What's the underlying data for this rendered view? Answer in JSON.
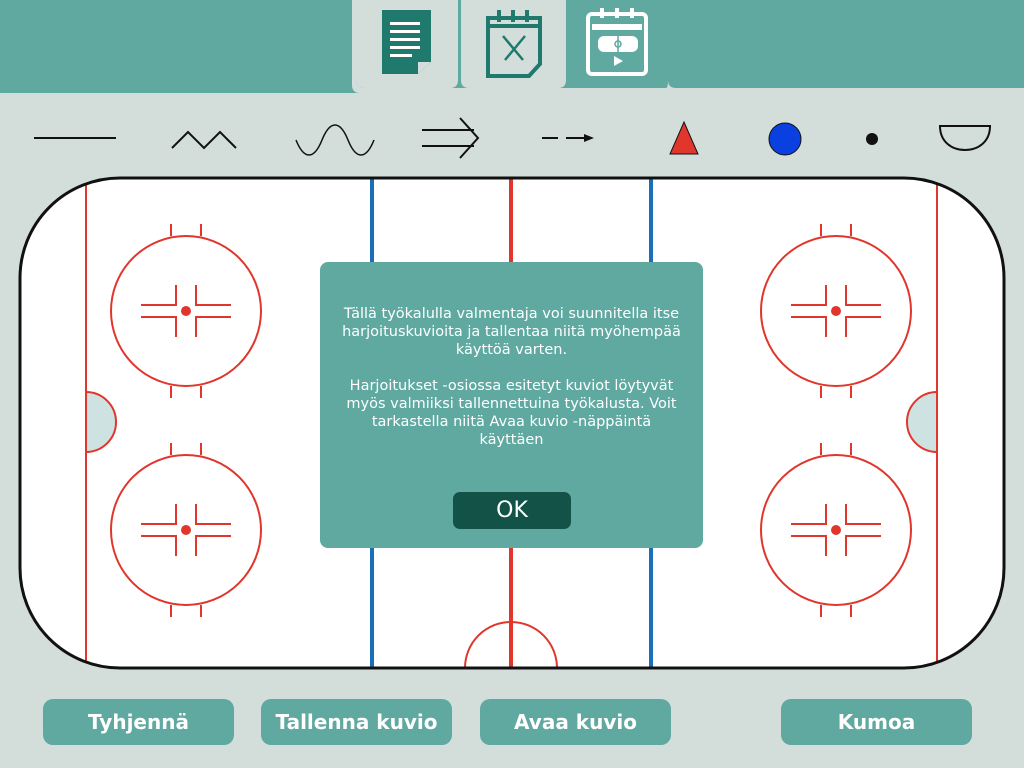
{
  "header": {
    "tabs": [
      {
        "name": "document-icon"
      },
      {
        "name": "practice-calendar-icon"
      },
      {
        "name": "rink-calendar-icon",
        "active": true
      }
    ]
  },
  "tools": [
    "straight-line-icon",
    "zigzag-line-icon",
    "wavy-line-icon",
    "double-arrow-icon",
    "dashed-arrow-icon",
    "red-triangle-icon",
    "blue-circle-icon",
    "black-dot-icon",
    "half-circle-icon"
  ],
  "dialog": {
    "paragraph1": "Tällä työkalulla valmentaja voi suunnitella itse\nharjoituskuvioita ja tallentaa niitä myöhempää\nkäyttöä varten.",
    "paragraph2": "Harjoitukset -osiossa esitetyt kuviot löytyvät\nmyös valmiiksi tallennettuina työkalusta. Voit\ntarkastella niitä Avaa kuvio -näppäintä\nkäyttäen",
    "ok_label": "OK"
  },
  "buttons": {
    "clear_label": "Tyhjennä",
    "save_label": "Tallenna kuvio",
    "open_label": "Avaa kuvio",
    "undo_label": "Kumoa"
  },
  "colors": {
    "accent": "#5fa9a1",
    "background": "#d3dedb",
    "dark_teal": "#135347",
    "rink_red": "#e0362c",
    "rink_blue": "#1a6fb8"
  }
}
